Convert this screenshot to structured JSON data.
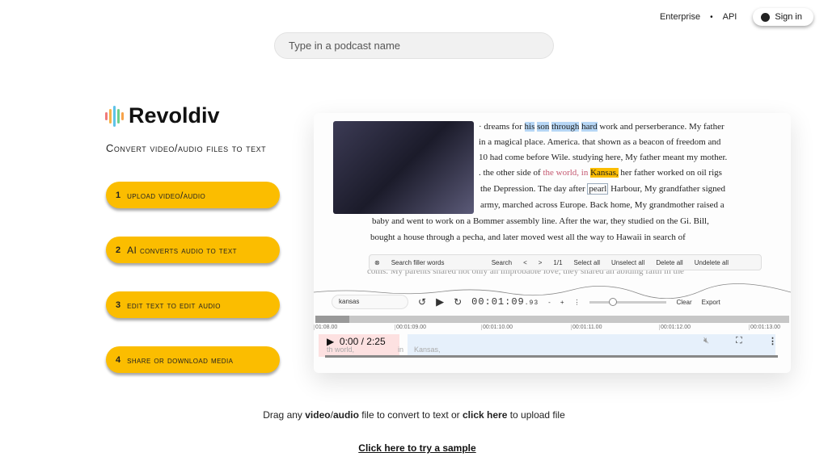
{
  "nav": {
    "enterprise": "Enterprise",
    "separator": "•",
    "api": "API",
    "signin": "Sign in"
  },
  "search": {
    "placeholder": "Type in a podcast name"
  },
  "brand": {
    "name": "Revoldiv",
    "tagline": "Convert video/audio files to text"
  },
  "steps": [
    {
      "num": "1",
      "label": "upload video/audio"
    },
    {
      "num": "2",
      "label": "AI converts audio to text"
    },
    {
      "num": "3",
      "label": "edit text to edit audio"
    },
    {
      "num": "4",
      "label": "share or download media"
    }
  ],
  "demo": {
    "lines": {
      "l1a": "· dreams for ",
      "l1b": "his",
      "l1c": "son",
      "l1d": "through",
      "l1e": "hard",
      "l1f": " work and perserberance. My father",
      "l2": "in a magical place. America. that shown as a beacon of freedom and",
      "l3": "10 had come before Wile. studying here, My father meant my mother.",
      "l4a": ". the other side of ",
      "l4b": "the world, in ",
      "l4c": "Kansas,",
      "l4d": " her father worked on oil rigs",
      "l5a": "the Depression. The day after ",
      "l5b": "pearl",
      "l5c": " Harbour, My grandfather signed",
      "l6": "army, marched across Europe. Back home, My grandmother raised a",
      "l7": "baby and went to work on a Bommer assembly line. After the war, they studied on the Gi. Bill,",
      "l8": "bought a house through a pecha, and later moved west all the way to Hawaii in search of",
      "l9": "coms. My parents shared not only an improbable love, they shared an abiding faith in the"
    },
    "filter": {
      "select": "Search filler words",
      "search": "Search",
      "prev": "<",
      "next": ">",
      "count": "1/1",
      "select_all": "Select all",
      "unselect_all": "Unselect all",
      "delete_all": "Delete all",
      "undelete_all": "Undelete all"
    },
    "controls": {
      "keyword": "kansas",
      "time": "00:01:09",
      "ms": ".93",
      "minus": "-",
      "plus": "+",
      "clear": "Clear",
      "export": "Export"
    },
    "ruler": [
      "01:08.00",
      "00:01:09.00",
      "00:01:10.00",
      "00:01:11.00",
      "00:01:12.00",
      "00:01:13.00"
    ],
    "player": {
      "time": "0:00 / 2:25",
      "w1": "th world,",
      "w2": "in",
      "w3": "Kansas,"
    }
  },
  "footer": {
    "drag_pre": "Drag any ",
    "video": "video",
    "slash": "/",
    "audio": "audio",
    "drag_mid": " file to convert to text or ",
    "click_here": "click here",
    "drag_post": " to upload file",
    "sample": "Click here to try a sample"
  }
}
